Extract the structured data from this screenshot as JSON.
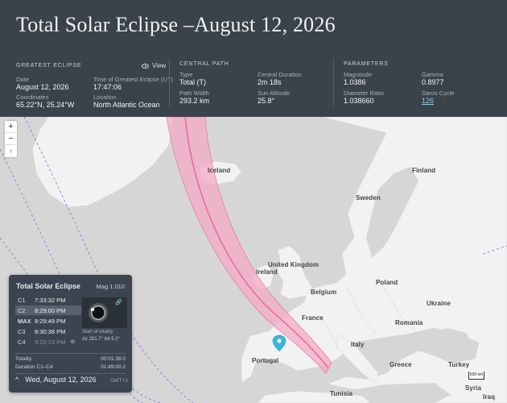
{
  "title": "Total Solar Eclipse –August 12, 2026",
  "greatest": {
    "heading": "GREATEST ECLIPSE",
    "view_label": "View",
    "date_label": "Date",
    "date": "August 12, 2026",
    "time_label": "Time of Greatest Eclipse (UT)",
    "time": "17:47:06",
    "coords_label": "Coordinates",
    "coords": "65.22°N, 25.24°W",
    "location_label": "Location",
    "location": "North Atlantic Ocean"
  },
  "central": {
    "heading": "CENTRAL PATH",
    "type_label": "Type",
    "type": "Total (T)",
    "duration_label": "Central Duration",
    "duration": "2m 18s",
    "width_label": "Path Width",
    "width": "293.2 km",
    "altitude_label": "Sun Altitude",
    "altitude": "25.8°"
  },
  "params": {
    "heading": "PARAMETERS",
    "magnitude_label": "Magnitude",
    "magnitude": "1.0386",
    "gamma_label": "Gamma",
    "gamma": "0.8977",
    "diameter_label": "Diameter Ratio",
    "diameter": "1.038660",
    "saros_label": "Saros Cycle",
    "saros": "126"
  },
  "map": {
    "labels": {
      "iceland": "Iceland",
      "finland": "Finland",
      "sweden": "Sweden",
      "uk": "United Kingdom",
      "ireland": "Ireland",
      "belgium": "Belgium",
      "poland": "Poland",
      "france": "France",
      "ukraine": "Ukraine",
      "romania": "Romania",
      "italy": "Italy",
      "portugal": "Portugal",
      "greece": "Greece",
      "turkey": "Turkey",
      "tunisia": "Tunisia",
      "syria": "Syria",
      "iraq": "Iraq"
    },
    "zoom_in": "+",
    "zoom_out": "−",
    "reset": "↑",
    "scale": "500 km"
  },
  "card": {
    "title": "Total Solar Eclipse",
    "mag": "Mag 1.010",
    "contacts": [
      {
        "key": "C1",
        "time": "7:33:32 PM"
      },
      {
        "key": "C2",
        "time": "8:29:00 PM"
      },
      {
        "key": "MAX",
        "time": "8:29:49 PM"
      },
      {
        "key": "C3",
        "time": "8:30:38 PM"
      },
      {
        "key": "C4",
        "time": "9:22:13 PM"
      }
    ],
    "start_label": "Start of totality",
    "az_alt": "Az 281.7° Alt 9.2°",
    "totality_label": "Totality",
    "totality_value": "00:01:38.0",
    "duration_label": "Duration C1–C4",
    "duration_value": "01:49:00.2",
    "date": "Wed, August 12, 2026",
    "tz": "GMT+2",
    "collapse_icon": "^"
  },
  "colors": {
    "header_bg": "#3a434c",
    "path_fill": "#f4a9c6",
    "path_line": "#e8629a",
    "pin": "#3fb2d6"
  }
}
